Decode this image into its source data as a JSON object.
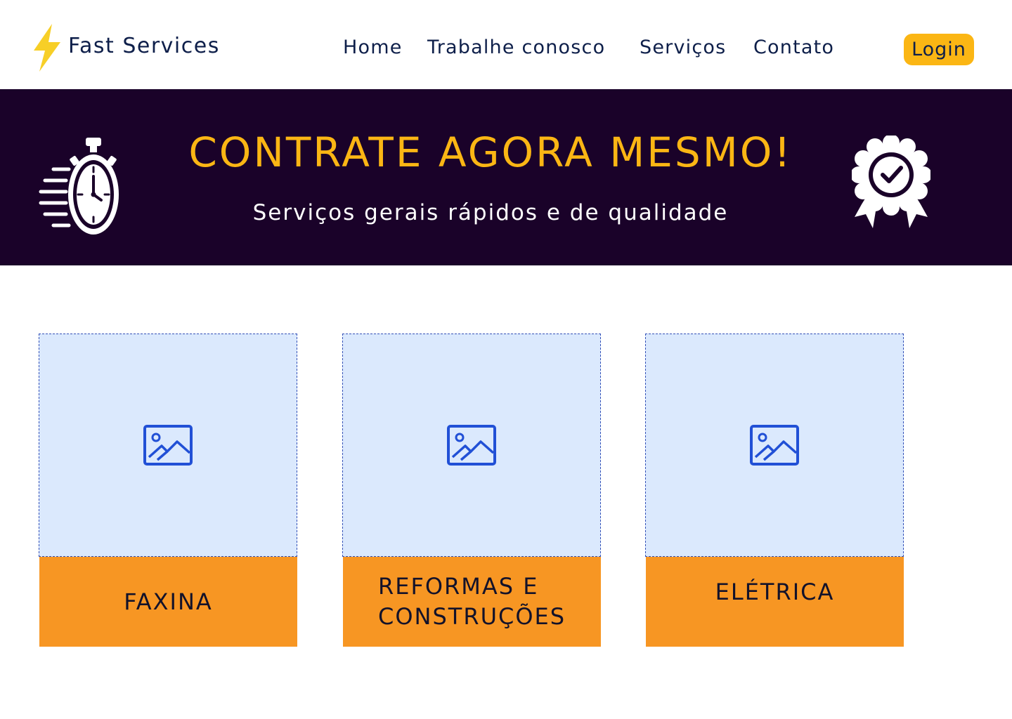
{
  "header": {
    "brand": "Fast Services",
    "logo_icon": "lightning-bolt-icon",
    "nav": [
      {
        "label": "Home"
      },
      {
        "label": "Trabalhe conosco"
      },
      {
        "label": "Serviços"
      },
      {
        "label": "Contato"
      }
    ],
    "login_label": "Login"
  },
  "hero": {
    "title": "CONTRATE AGORA MESMO!",
    "subtitle": "Serviços gerais rápidos e de qualidade",
    "left_icon": "stopwatch-icon",
    "right_icon": "award-badge-icon"
  },
  "cards": [
    {
      "label": "FAXINA",
      "image_icon": "image-placeholder-icon"
    },
    {
      "label_line1": "REFORMAS E",
      "label_line2": "CONSTRUÇÕES",
      "image_icon": "image-placeholder-icon"
    },
    {
      "label": "ELÉTRICA",
      "image_icon": "image-placeholder-icon"
    }
  ],
  "colors": {
    "accent": "#fbb614",
    "hero_bg": "#1a0229",
    "card_label_bg": "#f79623",
    "card_image_bg": "#dbe9fd",
    "text_navy": "#0e1f4a"
  }
}
